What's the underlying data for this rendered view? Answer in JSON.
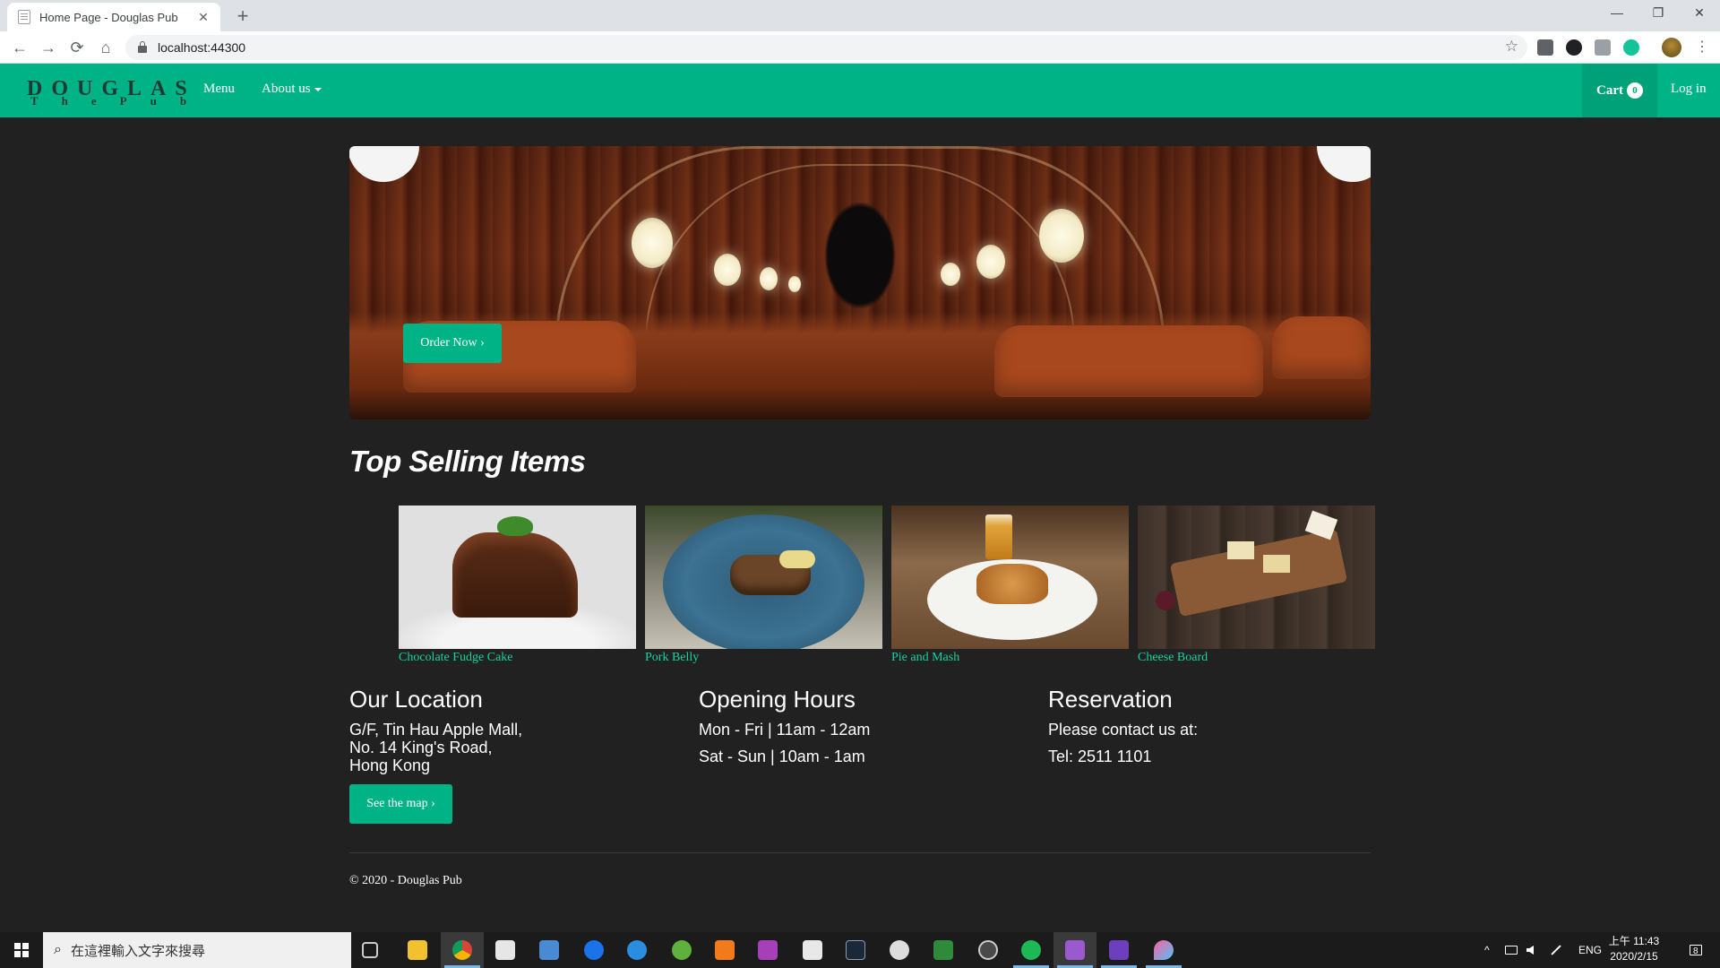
{
  "browser": {
    "tab_title": "Home Page - Douglas Pub",
    "tab_close": "✕",
    "new_tab": "+",
    "url": "localhost:44300",
    "back": "←",
    "forward": "→",
    "reload": "⟳",
    "home": "⌂",
    "bookmark_star": "☆",
    "menu": "⋮",
    "win_minimize": "—",
    "win_restore": "❐",
    "win_close": "✕"
  },
  "nav": {
    "logo_line1": "DOUGLAS",
    "logo_line2": "ThePub",
    "menu": "Menu",
    "about": "About us",
    "cart": "Cart",
    "cart_count": "0",
    "login": "Log in"
  },
  "hero": {
    "order_button": "Order Now ›"
  },
  "top_selling": {
    "title": "Top Selling Items",
    "items": [
      {
        "name": "Chocolate Fudge Cake"
      },
      {
        "name": "Pork Belly"
      },
      {
        "name": "Pie and Mash"
      },
      {
        "name": "Cheese Board"
      }
    ]
  },
  "location": {
    "title": "Our Location",
    "lines": [
      "G/F, Tin Hau Apple Mall,",
      "No. 14 King's Road,",
      "Hong Kong"
    ],
    "map_button": "See the map ›"
  },
  "hours": {
    "title": "Opening Hours",
    "lines": [
      "Mon - Fri | 11am - 12am",
      "Sat - Sun | 10am - 1am"
    ]
  },
  "reservation": {
    "title": "Reservation",
    "lines": [
      "Please contact us at:",
      "Tel: 2511 1101"
    ]
  },
  "footer": {
    "text": "© 2020 - Douglas Pub"
  },
  "taskbar": {
    "search_placeholder": "在這裡輸入文字來搜尋",
    "search_icon": "⌕",
    "tray_lang": "ENG",
    "tray_chevron": "^",
    "clock_time": "上午 11:43",
    "clock_date": "2020/2/15",
    "notification_count": "8"
  },
  "colors": {
    "accent": "#00b386",
    "accent_dark": "#00a079",
    "item_link": "#14d59f",
    "page_bg": "#212121"
  }
}
